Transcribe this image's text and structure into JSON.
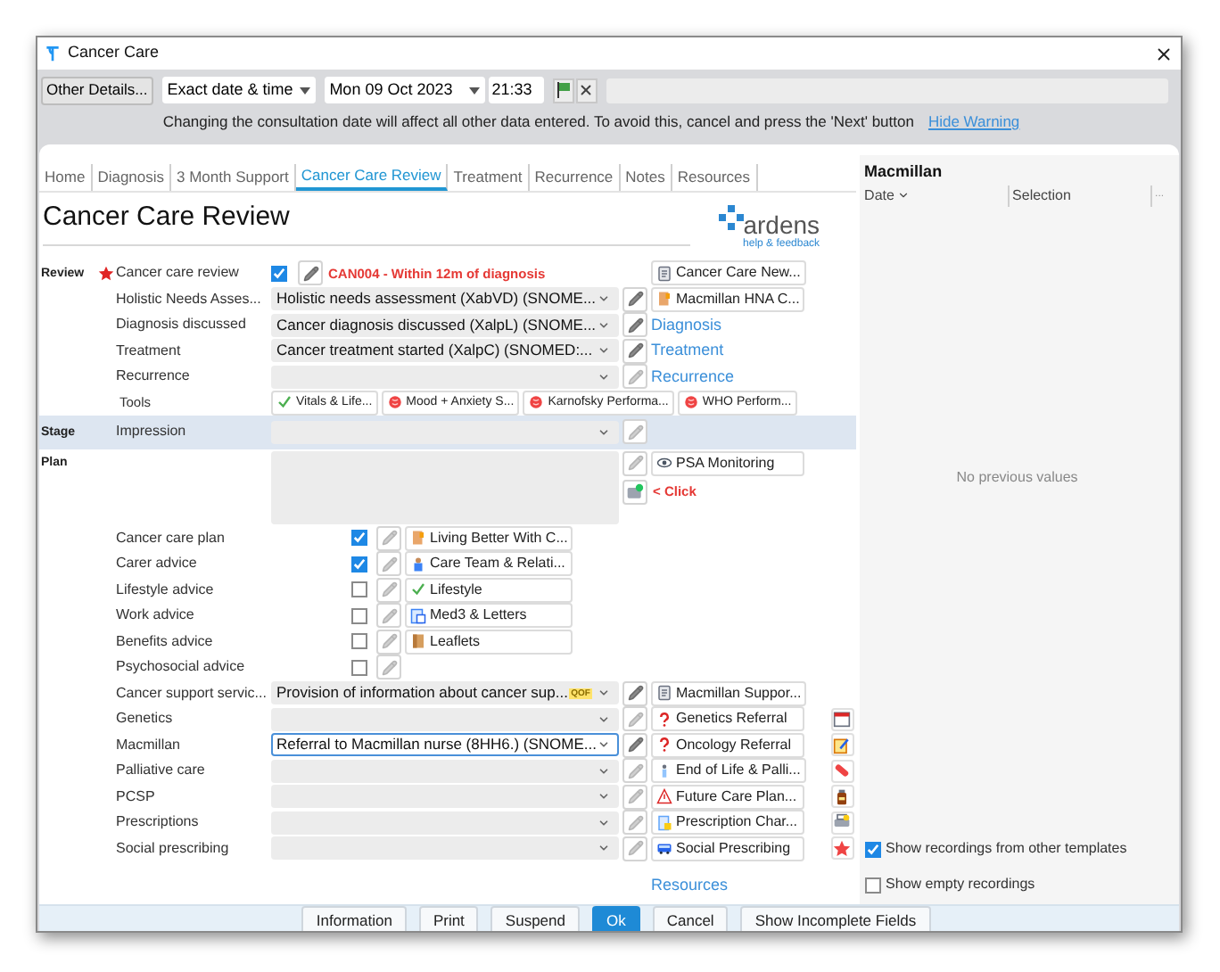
{
  "window": {
    "title": "Cancer Care"
  },
  "toolbar": {
    "details_button": "Other Details...",
    "date_mode": "Exact date & time",
    "date": "Mon 09 Oct 2023",
    "time": "21:33"
  },
  "warning": {
    "text": "Changing the consultation date will affect all other data entered. To avoid this, cancel and press the 'Next' button",
    "link": "Hide Warning"
  },
  "tabs": [
    {
      "label": "Home",
      "selected": false
    },
    {
      "label": "Diagnosis",
      "selected": false
    },
    {
      "label": "3 Month Support",
      "selected": false
    },
    {
      "label": "Cancer Care Review",
      "selected": true
    },
    {
      "label": "Treatment",
      "selected": false
    },
    {
      "label": "Recurrence",
      "selected": false
    },
    {
      "label": "Notes",
      "selected": false
    },
    {
      "label": "Resources",
      "selected": false
    }
  ],
  "form": {
    "title": "Cancer Care Review",
    "logo": "ardens",
    "logo_link": "help & feedback",
    "sections": [
      {
        "label": "Review",
        "highlighted": false,
        "rows": [
          {
            "kind": "check_note",
            "label": "Cancer care review",
            "required": true,
            "checked": true,
            "note": "CAN004 - Within 12m of diagnosis",
            "action": {
              "label": "Cancer Care New..."
            }
          },
          {
            "kind": "select",
            "label": "Holistic Needs Asses...",
            "value": "Holistic needs assessment (XabVD) (SNOME...",
            "focused": false,
            "action": {
              "label": "Macmillan HNA C..."
            }
          },
          {
            "kind": "select",
            "label": "Diagnosis discussed",
            "value": "Cancer diagnosis discussed (XalpL) (SNOME...",
            "focused": false,
            "link": "Diagnosis"
          },
          {
            "kind": "select",
            "label": "Treatment",
            "value": "Cancer treatment started (XalpC) (SNOMED:...",
            "focused": false,
            "link": "Treatment"
          },
          {
            "kind": "select",
            "label": "Recurrence",
            "focused": false,
            "link": "Recurrence"
          },
          {
            "kind": "tools",
            "label": "Tools",
            "tools": [
              {
                "label": "Vitals & Life..."
              },
              {
                "label": "Mood + Anxiety S..."
              },
              {
                "label": "Karnofsky Performa..."
              },
              {
                "label": "WHO Perform..."
              }
            ]
          }
        ]
      },
      {
        "label": "Stage",
        "highlighted": true,
        "rows": [
          {
            "kind": "select",
            "label": "Impression",
            "focused": false
          }
        ]
      },
      {
        "label": "Plan",
        "highlighted": false,
        "rows": [
          {
            "kind": "textarea",
            "action": {
              "label": "PSA Monitoring"
            },
            "hint": "< Click"
          },
          {
            "kind": "check",
            "label": "Cancer care plan",
            "checked": true,
            "action": {
              "label": "Living Better With C..."
            }
          },
          {
            "kind": "check",
            "label": "Carer advice",
            "checked": true,
            "action": {
              "label": "Care Team & Relati..."
            }
          },
          {
            "kind": "check",
            "label": "Lifestyle advice",
            "checked": false,
            "action": {
              "label": "Lifestyle"
            }
          },
          {
            "kind": "check",
            "label": "Work advice",
            "checked": false,
            "action": {
              "label": "Med3 & Letters"
            }
          },
          {
            "kind": "check",
            "label": "Benefits advice",
            "checked": false,
            "action": {
              "label": "Leaflets"
            }
          },
          {
            "kind": "check",
            "label": "Psychosocial advice",
            "checked": false
          },
          {
            "kind": "select",
            "label": "Cancer support servic...",
            "value": "Provision of information about cancer sup...",
            "badge": "QOF",
            "focused": false,
            "action": {
              "label": "Macmillan Suppor..."
            }
          },
          {
            "kind": "select",
            "label": "Genetics",
            "focused": false,
            "action": {
              "label": "Genetics Referral"
            }
          },
          {
            "kind": "select",
            "label": "Macmillan",
            "value": "Referral to Macmillan nurse (8HH6.) (SNOME...",
            "focused": true,
            "action": {
              "label": "Oncology Referral"
            }
          },
          {
            "kind": "select",
            "label": "Palliative care",
            "focused": false,
            "action": {
              "label": "End of Life & Palli..."
            }
          },
          {
            "kind": "select",
            "label": "PCSP",
            "focused": false,
            "action": {
              "label": "Future Care Plan..."
            }
          },
          {
            "kind": "select",
            "label": "Prescriptions",
            "focused": false,
            "action": {
              "label": "Prescription Char..."
            }
          },
          {
            "kind": "select",
            "label": "Social prescribing",
            "focused": false,
            "action": {
              "label": "Social Prescribing"
            }
          }
        ]
      }
    ],
    "footer_link": "Resources"
  },
  "history": {
    "title": "Macmillan",
    "columns": [
      "Date",
      "Selection",
      "..."
    ],
    "empty_text": "No previous values",
    "options": [
      {
        "label": "Show recordings from other templates",
        "checked": true
      },
      {
        "label": "Show empty recordings",
        "checked": false
      }
    ]
  },
  "buttons": [
    {
      "label": "Information",
      "default": false
    },
    {
      "label": "Print",
      "default": false
    },
    {
      "label": "Suspend",
      "default": false
    },
    {
      "label": "Ok",
      "default": true
    },
    {
      "label": "Cancel",
      "default": false
    },
    {
      "label": "Show Incomplete Fields",
      "default": false
    }
  ]
}
